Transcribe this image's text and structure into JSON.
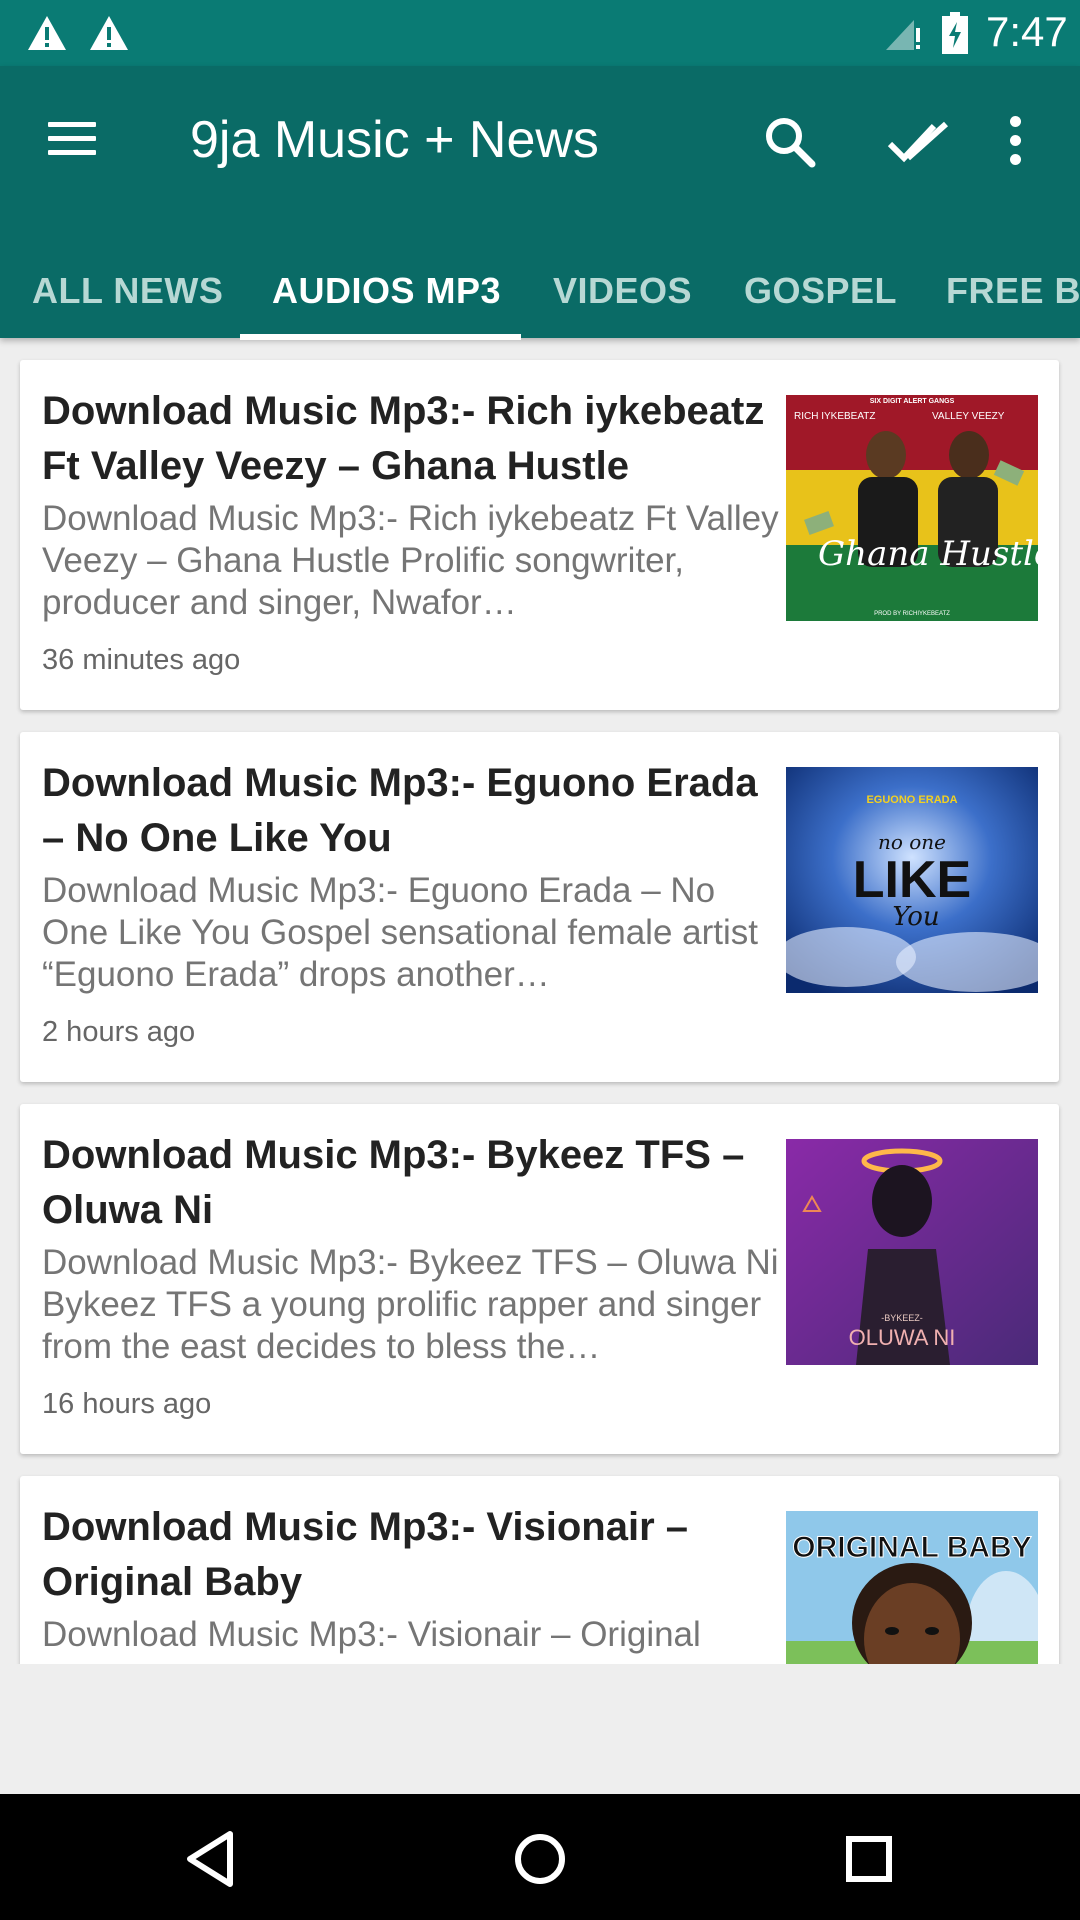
{
  "status_bar": {
    "time": "7:47",
    "icons": [
      "warning-icon",
      "warning-icon",
      "signal-icon",
      "battery-icon"
    ]
  },
  "app_bar": {
    "title": "9ja Music + News",
    "icons": [
      "menu-icon",
      "search-icon",
      "mark-read-icon",
      "more-icon"
    ],
    "colors": {
      "status": "#0a7b74",
      "toolbar": "#0a6b66"
    }
  },
  "tabs": [
    {
      "label": "ALL NEWS",
      "active": false
    },
    {
      "label": "AUDIOS MP3",
      "active": true
    },
    {
      "label": "VIDEOS",
      "active": false
    },
    {
      "label": "GOSPEL",
      "active": false
    },
    {
      "label": "FREE BE",
      "active": false
    }
  ],
  "articles": [
    {
      "title": "Download Music Mp3:- Rich iykebeatz Ft Valley Veezy – Ghana Hustle",
      "excerpt": "Download Music Mp3:- Rich iykebeatz Ft Valley Veezy – Ghana Hustle Prolific songwriter, producer and singer, Nwafor…",
      "time": "36 minutes ago",
      "thumb_text": [
        "SIX DIGIT ALERT GANGS",
        "RICH IYKEBEATZ",
        "VALLEY VEEZY",
        "Ghana Hustle",
        "PROD BY RICHIYKEBEATZ"
      ]
    },
    {
      "title": "Download Music Mp3:- Eguono Erada – No One Like You",
      "excerpt": "Download Music Mp3:- Eguono Erada – No One Like You Gospel sensational female artist “Eguono Erada” drops another…",
      "time": "2 hours ago",
      "thumb_text": [
        "EGUONO ERADA",
        "no one",
        "LIKE",
        "You"
      ]
    },
    {
      "title": "Download Music Mp3:- Bykeez TFS – Oluwa Ni",
      "excerpt": "Download Music Mp3:- Bykeez TFS – Oluwa Ni Bykeez TFS a young prolific rapper and singer from the east decides to bless the…",
      "time": "16 hours ago",
      "thumb_text": [
        "-BYKEEZ-",
        "OLUWA NI"
      ]
    },
    {
      "title": "Download Music Mp3:- Visionair – Original Baby",
      "excerpt": "Download Music Mp3:- Visionair – Original",
      "time": "",
      "thumb_text": [
        "ORIGINAL BABY"
      ]
    }
  ],
  "nav_bar": {
    "icons": [
      "back-icon",
      "home-icon",
      "recents-icon"
    ]
  }
}
